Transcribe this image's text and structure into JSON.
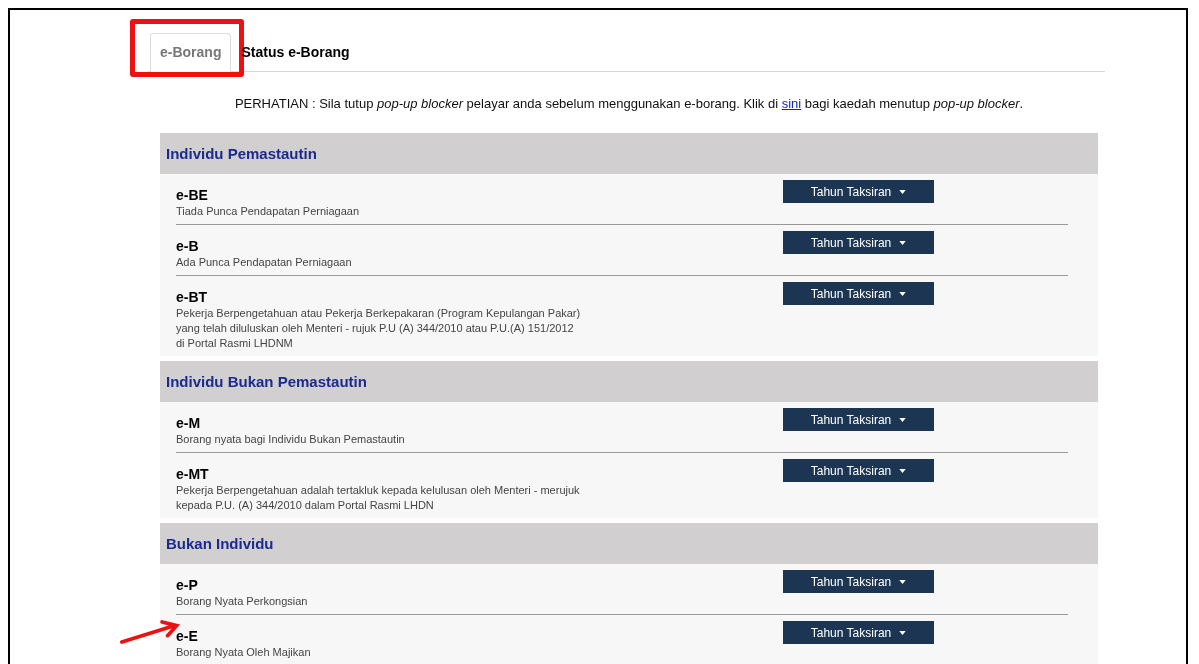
{
  "tabs": [
    {
      "label": "e-Borang",
      "selected": true,
      "highlighted": true
    },
    {
      "label": "Status e-Borang",
      "selected": false,
      "highlighted": false
    }
  ],
  "notice": "PERHATIAN : Sila tutup *pop-up blocker* pelayar anda sebelum menggunakan e-borang. Klik di ",
  "notice_link": "sini",
  "notice_end": " bagi kaedah menutup *pop-up blocker*.",
  "sections": [
    {
      "title": "Individu Pemastautin",
      "forms": [
        {
          "code": "e-BE",
          "description": "Tiada Punca Pendapatan Perniagaan",
          "button": "Tahun Taksiran",
          "marked": false
        },
        {
          "code": "e-B",
          "description": "Ada Punca Pendapatan Perniagaan",
          "button": "Tahun Taksiran",
          "marked": false
        },
        {
          "code": "e-BT",
          "description": "Pekerja Berpengetahuan atau Pekerja Berkepakaran (Program Kepulangan Pakar) yang telah diluluskan oleh Menteri - rujuk P.U (A) 344/2010 atau P.U.(A) 151/2012 di Portal Rasmi LHDNM",
          "button": "Tahun Taksiran",
          "marked": false
        }
      ]
    },
    {
      "title": "Individu Bukan Pemastautin",
      "forms": [
        {
          "code": "e-M",
          "description": "Borang nyata bagi Individu Bukan Pemastautin",
          "button": "Tahun Taksiran",
          "marked": false
        },
        {
          "code": "e-MT",
          "description": "Pekerja Berpengetahuan adalah tertakluk kepada kelulusan oleh Menteri - merujuk kepada P.U. (A) 344/2010 dalam Portal Rasmi LHDN",
          "button": "Tahun Taksiran",
          "marked": false
        }
      ]
    },
    {
      "title": "Bukan Individu",
      "forms": [
        {
          "code": "e-P",
          "description": "Borang Nyata Perkongsian",
          "button": "Tahun Taksiran",
          "marked": false
        },
        {
          "code": "e-E",
          "description": "Borang Nyata Oleh Majikan",
          "button": "Tahun Taksiran",
          "marked": true
        }
      ]
    }
  ]
}
